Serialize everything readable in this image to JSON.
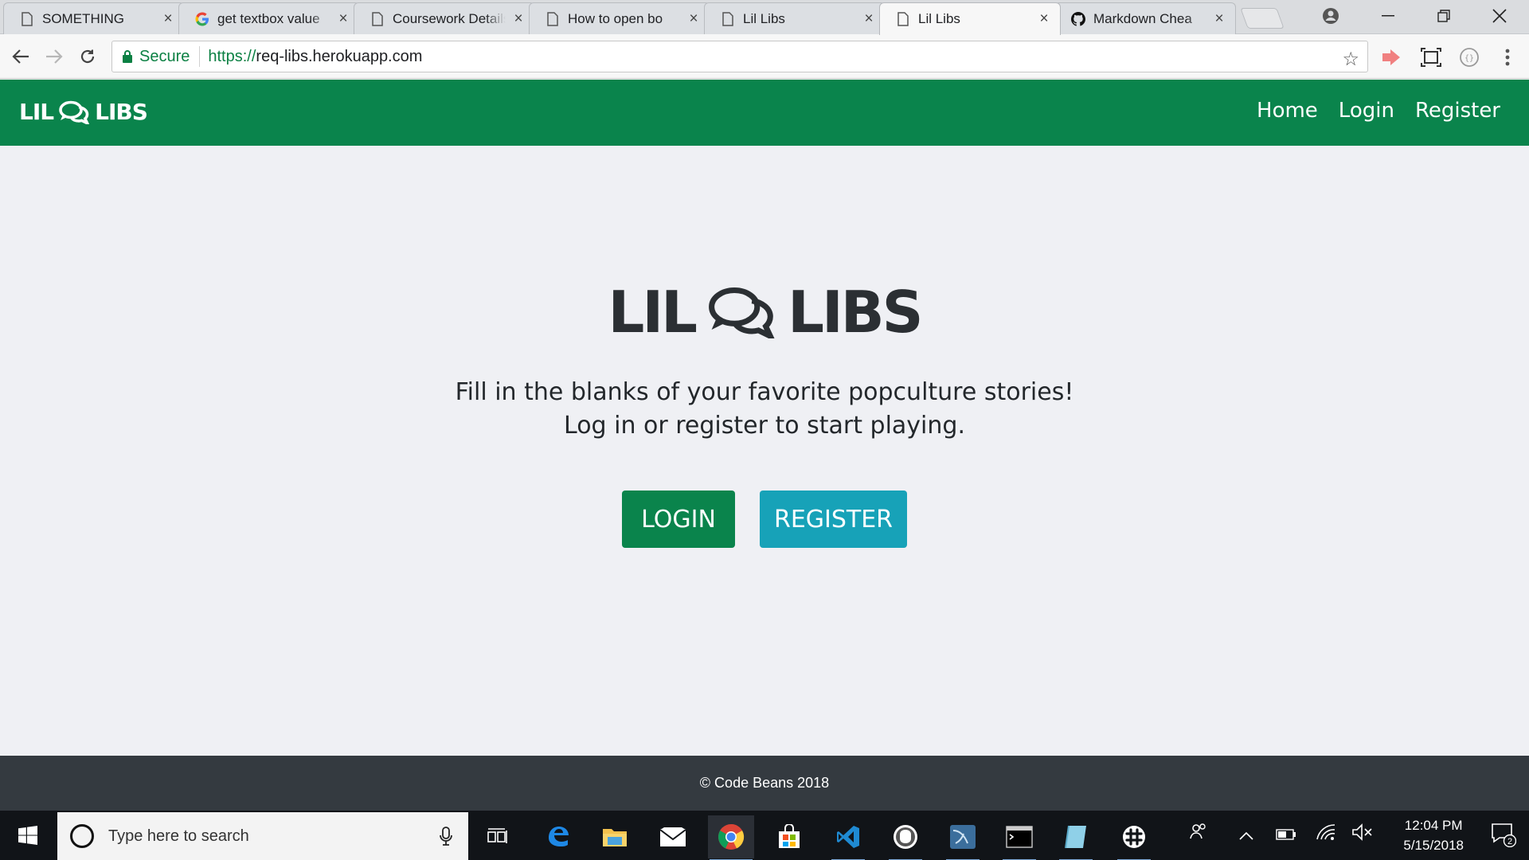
{
  "browser": {
    "tabs": [
      {
        "title": "SOMETHING",
        "favicon": "page-icon",
        "active": false
      },
      {
        "title": "get textbox value",
        "favicon": "google-icon",
        "active": false
      },
      {
        "title": "Coursework Details",
        "favicon": "page-icon",
        "active": false
      },
      {
        "title": "How to open bo",
        "favicon": "page-icon",
        "active": false
      },
      {
        "title": "Lil Libs",
        "favicon": "page-icon",
        "active": false
      },
      {
        "title": "Lil Libs",
        "favicon": "page-icon",
        "active": true
      },
      {
        "title": "Markdown Chea",
        "favicon": "github-icon",
        "active": false
      }
    ],
    "secure_label": "Secure",
    "url_scheme": "https://",
    "url_host": "req-libs.herokuapp.com",
    "close_glyph": "×"
  },
  "site": {
    "brand_left": "LIL",
    "brand_right": "LIBS",
    "nav": {
      "home": "Home",
      "login": "Login",
      "register": "Register"
    },
    "hero": {
      "logo_left": "LIL",
      "logo_right": "LIBS",
      "tagline": "Fill in the blanks of your favorite popculture stories! Log in or register to start playing.",
      "login_button": "LOGIN",
      "register_button": "REGISTER"
    },
    "footer": "© Code Beans 2018",
    "colors": {
      "primary_green": "#0a844c",
      "info_teal": "#17a2b8",
      "footer_dark": "#343a40",
      "background": "#eff0f4"
    }
  },
  "taskbar": {
    "search_placeholder": "Type here to search",
    "time": "12:04 PM",
    "date": "5/15/2018",
    "notification_count": "2"
  }
}
